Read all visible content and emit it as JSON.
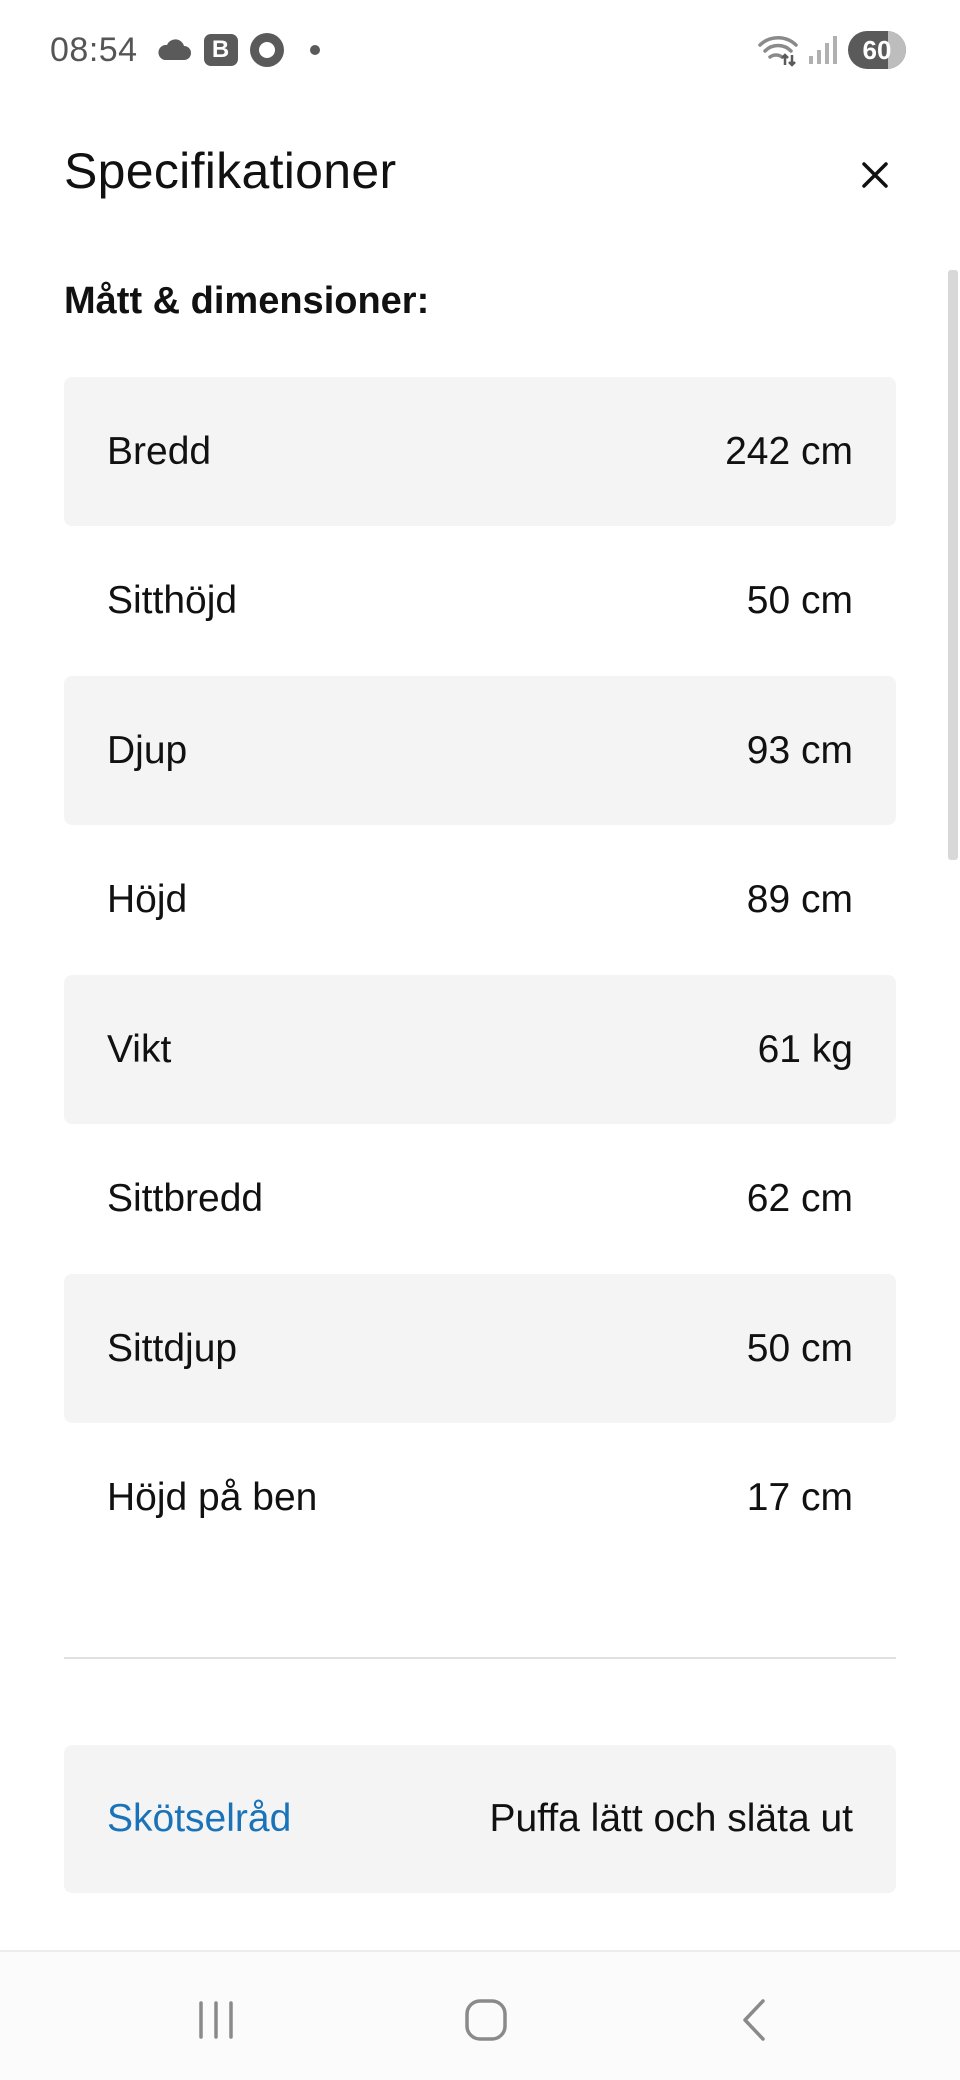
{
  "status_bar": {
    "time": "08:54",
    "badge_b": "B",
    "battery": "60",
    "icons": [
      "cloud-icon",
      "b-badge-icon",
      "o-badge-icon",
      "dot-icon",
      "wifi-icon",
      "signal-icon",
      "battery-icon"
    ]
  },
  "header": {
    "title": "Specifikationer",
    "close_icon": "close-icon"
  },
  "section": {
    "heading": "Mått & dimensioner:"
  },
  "specs": [
    {
      "label": "Bredd",
      "value": "242 cm"
    },
    {
      "label": "Sitthöjd",
      "value": "50 cm"
    },
    {
      "label": "Djup",
      "value": "93 cm"
    },
    {
      "label": "Höjd",
      "value": "89 cm"
    },
    {
      "label": "Vikt",
      "value": "61 kg"
    },
    {
      "label": "Sittbredd",
      "value": "62 cm"
    },
    {
      "label": "Sittdjup",
      "value": "50 cm"
    },
    {
      "label": "Höjd på ben",
      "value": "17 cm"
    }
  ],
  "care": {
    "label": "Skötselråd",
    "value": "Puffa lätt och släta ut"
  },
  "colors": {
    "link": "#1a73b8",
    "row_shade": "#f4f4f4",
    "text": "#111111"
  },
  "nav_bar": {
    "icons": [
      "recents-icon",
      "home-icon",
      "back-icon"
    ]
  }
}
